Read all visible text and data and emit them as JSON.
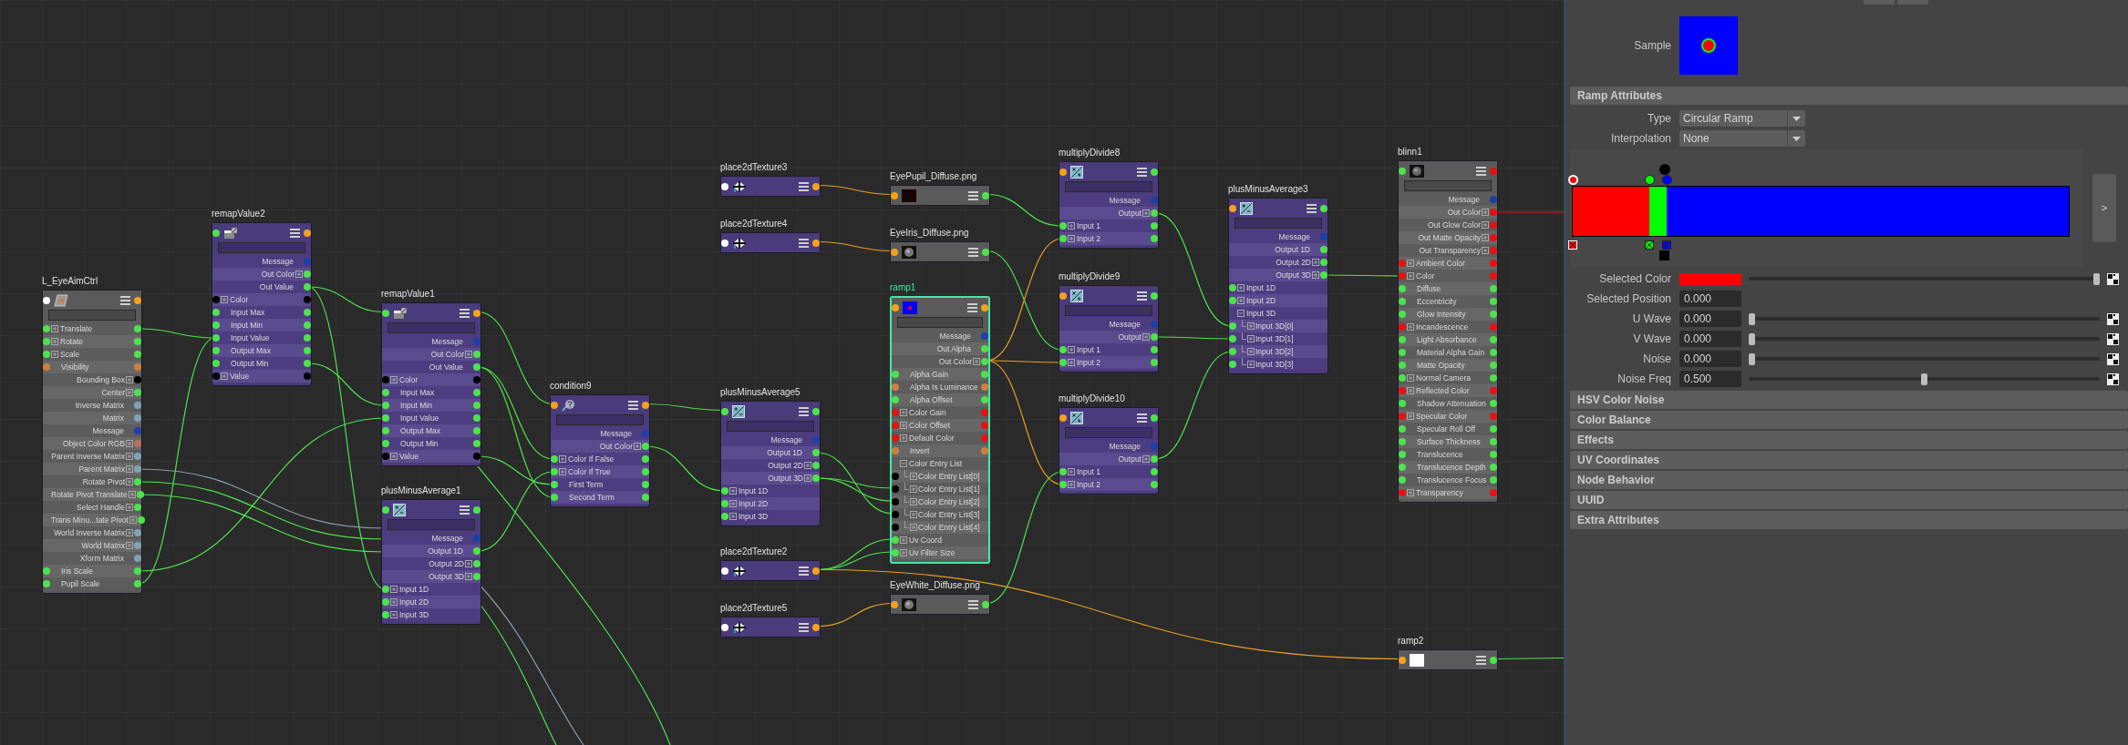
{
  "node_editor": {
    "nodes": [
      {
        "name": "L_EyeAimCtrl",
        "kind": "transform",
        "selected": false,
        "in_port": {
          "color": "#ffffff"
        },
        "out_port": {
          "color": "#f4a21c"
        },
        "attributes": [
          {
            "label": "Translate",
            "kind": "io",
            "compound": true,
            "color": "#4de34d"
          },
          {
            "label": "Rotate",
            "kind": "io",
            "compound": true,
            "color": "#4de34d"
          },
          {
            "label": "Scale",
            "kind": "io",
            "compound": true,
            "color": "#4de34d"
          },
          {
            "label": "Visibility",
            "kind": "io",
            "compound": false,
            "color": "#d0803c"
          },
          {
            "label": "Bounding Box",
            "kind": "out",
            "compound": true,
            "color": "#000000"
          },
          {
            "label": "Center",
            "kind": "out",
            "compound": true,
            "color": "#4de34d"
          },
          {
            "label": "Inverse Matrix",
            "kind": "out",
            "compound": false,
            "color": "#7ea4b8"
          },
          {
            "label": "Matrix",
            "kind": "out",
            "compound": false,
            "color": "#7ea4b8"
          },
          {
            "label": "Message",
            "kind": "out",
            "compound": false,
            "color": "#1c3fa8"
          },
          {
            "label": "Object Color RGB",
            "kind": "out",
            "compound": true,
            "color": "#b87060"
          },
          {
            "label": "Parent Inverse Matrix",
            "kind": "out",
            "compound": true,
            "color": "#7ea4b8"
          },
          {
            "label": "Parent Matrix",
            "kind": "out",
            "compound": true,
            "color": "#7ea4b8"
          },
          {
            "label": "Rotate Pivot",
            "kind": "out",
            "compound": true,
            "color": "#4de34d"
          },
          {
            "label": "Rotate Pivot Translate",
            "kind": "out",
            "compound": true,
            "color": "#4de34d"
          },
          {
            "label": "Select Handle",
            "kind": "out",
            "compound": true,
            "color": "#4de34d"
          },
          {
            "label": "Trans Minu...tate Pivot",
            "kind": "out",
            "compound": true,
            "color": "#4de34d"
          },
          {
            "label": "World Inverse Matrix",
            "kind": "out",
            "compound": true,
            "color": "#7ea4b8"
          },
          {
            "label": "World Matrix",
            "kind": "out",
            "compound": true,
            "color": "#7ea4b8"
          },
          {
            "label": "Xform Matrix",
            "kind": "out",
            "compound": false,
            "color": "#7ea4b8"
          },
          {
            "label": "Iris Scale",
            "kind": "io",
            "compound": false,
            "color": "#4de34d"
          },
          {
            "label": "Pupil Scale",
            "kind": "io",
            "compound": false,
            "color": "#4de34d"
          }
        ]
      },
      {
        "name": "remapValue2",
        "kind": "remap",
        "selected": false,
        "in_port": {
          "color": "#4de34d"
        },
        "out_port": {
          "color": "#f4a21c"
        },
        "attributes": [
          {
            "label": "Message",
            "kind": "out",
            "compound": false,
            "color": "#1c3fa8"
          },
          {
            "label": "Out Color",
            "kind": "out",
            "compound": true,
            "color": "#4de34d"
          },
          {
            "label": "Out Value",
            "kind": "out",
            "compound": false,
            "color": "#4de34d"
          },
          {
            "label": "Color",
            "kind": "io",
            "compound": true,
            "color": "#000000"
          },
          {
            "label": "Input Max",
            "kind": "io",
            "compound": false,
            "color": "#4de34d"
          },
          {
            "label": "Input Min",
            "kind": "io",
            "compound": false,
            "color": "#4de34d"
          },
          {
            "label": "Input Value",
            "kind": "io",
            "compound": false,
            "color": "#4de34d"
          },
          {
            "label": "Output Max",
            "kind": "io",
            "compound": false,
            "color": "#4de34d"
          },
          {
            "label": "Output Min",
            "kind": "io",
            "compound": false,
            "color": "#4de34d"
          },
          {
            "label": "Value",
            "kind": "io",
            "compound": true,
            "color": "#000000"
          }
        ]
      },
      {
        "name": "remapValue1",
        "kind": "remap",
        "selected": false,
        "in_port": {
          "color": "#4de34d"
        },
        "out_port": {
          "color": "#f4a21c"
        },
        "attributes": [
          {
            "label": "Message",
            "kind": "out",
            "compound": false,
            "color": "#1c3fa8"
          },
          {
            "label": "Out Color",
            "kind": "out",
            "compound": true,
            "color": "#4de34d"
          },
          {
            "label": "Out Value",
            "kind": "out",
            "compound": false,
            "color": "#4de34d"
          },
          {
            "label": "Color",
            "kind": "io",
            "compound": true,
            "color": "#000000"
          },
          {
            "label": "Input Max",
            "kind": "io",
            "compound": false,
            "color": "#4de34d"
          },
          {
            "label": "Input Min",
            "kind": "io",
            "compound": false,
            "color": "#4de34d"
          },
          {
            "label": "Input Value",
            "kind": "io",
            "compound": false,
            "color": "#4de34d"
          },
          {
            "label": "Output Max",
            "kind": "io",
            "compound": false,
            "color": "#4de34d"
          },
          {
            "label": "Output Min",
            "kind": "io",
            "compound": false,
            "color": "#4de34d"
          },
          {
            "label": "Value",
            "kind": "io",
            "compound": true,
            "color": "#000000"
          }
        ]
      },
      {
        "name": "plusMinusAverage1",
        "kind": "plus_minus",
        "selected": false,
        "in_port": {
          "color": "#4de34d"
        },
        "out_port": {
          "color": "#4de34d"
        },
        "attributes": [
          {
            "label": "Message",
            "kind": "out",
            "compound": false,
            "color": "#1c3fa8"
          },
          {
            "label": "Output 1D",
            "kind": "out",
            "compound": false,
            "color": "#4de34d"
          },
          {
            "label": "Output 2D",
            "kind": "out",
            "compound": true,
            "color": "#4de34d"
          },
          {
            "label": "Output 3D",
            "kind": "out",
            "compound": true,
            "color": "#4de34d"
          },
          {
            "label": "Input 1D",
            "kind": "in",
            "compound": true,
            "color": "#4de34d"
          },
          {
            "label": "Input 2D",
            "kind": "in",
            "compound": true,
            "color": "#4de34d"
          },
          {
            "label": "Input 3D",
            "kind": "in",
            "compound": true,
            "color": "#4de34d"
          }
        ]
      },
      {
        "name": "condition9",
        "kind": "condition",
        "selected": false,
        "in_port": {
          "color": "#f4a21c"
        },
        "out_port": {
          "color": "#f4a21c"
        },
        "attributes": [
          {
            "label": "Message",
            "kind": "out",
            "compound": false,
            "color": "#1c3fa8"
          },
          {
            "label": "Out Color",
            "kind": "out",
            "compound": true,
            "color": "#4de34d"
          },
          {
            "label": "Color If False",
            "kind": "io",
            "compound": true,
            "color": "#4de34d"
          },
          {
            "label": "Color If True",
            "kind": "io",
            "compound": true,
            "color": "#4de34d"
          },
          {
            "label": "First Term",
            "kind": "io",
            "compound": false,
            "color": "#4de34d"
          },
          {
            "label": "Second Term",
            "kind": "io",
            "compound": false,
            "color": "#4de34d"
          }
        ]
      },
      {
        "name": "place2dTexture3",
        "kind": "place2d",
        "selected": false,
        "in_port": {
          "color": "#ffffff"
        },
        "out_port": {
          "color": "#f4a21c"
        }
      },
      {
        "name": "place2dTexture4",
        "kind": "place2d",
        "selected": false,
        "in_port": {
          "color": "#ffffff"
        },
        "out_port": {
          "color": "#f4a21c"
        }
      },
      {
        "name": "plusMinusAverage5",
        "kind": "plus_minus",
        "selected": false,
        "in_port": {
          "color": "#4de34d"
        },
        "out_port": {
          "color": "#4de34d"
        },
        "attributes": [
          {
            "label": "Message",
            "kind": "out",
            "compound": false,
            "color": "#1c3fa8"
          },
          {
            "label": "Output 1D",
            "kind": "out",
            "compound": false,
            "color": "#4de34d"
          },
          {
            "label": "Output 2D",
            "kind": "out",
            "compound": true,
            "color": "#4de34d"
          },
          {
            "label": "Output 3D",
            "kind": "out",
            "compound": true,
            "color": "#4de34d"
          },
          {
            "label": "Input 1D",
            "kind": "in",
            "compound": true,
            "color": "#4de34d"
          },
          {
            "label": "Input 2D",
            "kind": "in",
            "compound": true,
            "color": "#4de34d"
          },
          {
            "label": "Input 3D",
            "kind": "in",
            "compound": true,
            "color": "#4de34d"
          }
        ]
      },
      {
        "name": "place2dTexture2",
        "kind": "place2d",
        "selected": false,
        "in_port": {
          "color": "#ffffff"
        },
        "out_port": {
          "color": "#f4a21c"
        }
      },
      {
        "name": "place2dTexture5",
        "kind": "place2d",
        "selected": false,
        "in_port": {
          "color": "#ffffff"
        },
        "out_port": {
          "color": "#f4a21c"
        }
      },
      {
        "name": "EyePupil_Diffuse.png",
        "kind": "file",
        "selected": false,
        "in_port": {
          "color": "#f4a21c"
        },
        "out_port": {
          "color": "#4de34d"
        },
        "color": "#140404"
      },
      {
        "name": "EyeIris_Diffuse.png",
        "kind": "file",
        "selected": false,
        "in_port": {
          "color": "#f4a21c"
        },
        "out_port": {
          "color": "#4de34d"
        }
      },
      {
        "name": "ramp1",
        "kind": "ramp",
        "selected": true,
        "in_port": {
          "color": "#f4a21c"
        },
        "out_port": {
          "color": "#f4a21c"
        },
        "color": "#0000ff",
        "dot": {
          "color": "#ff0000"
        },
        "attributes": [
          {
            "label": "Message",
            "kind": "out",
            "compound": false,
            "color": "#1c3fa8"
          },
          {
            "label": "Out Alpha",
            "kind": "out",
            "compound": false,
            "color": "#4de34d"
          },
          {
            "label": "Out Color",
            "kind": "out",
            "compound": true,
            "color": "#4de34d"
          },
          {
            "label": "Alpha Gain",
            "kind": "io",
            "compound": false,
            "color": "#4de34d"
          },
          {
            "label": "Alpha Is Luminance",
            "kind": "io",
            "compound": false,
            "color": "#d0803c"
          },
          {
            "label": "Alpha Offset",
            "kind": "io",
            "compound": false,
            "color": "#4de34d"
          },
          {
            "label": "Color Gain",
            "kind": "io",
            "compound": true,
            "color": "#e81010"
          },
          {
            "label": "Color Offset",
            "kind": "io",
            "compound": true,
            "color": "#e81010"
          },
          {
            "label": "Default Color",
            "kind": "io",
            "compound": true,
            "color": "#e81010"
          },
          {
            "label": "Invert",
            "kind": "io",
            "compound": false,
            "color": "#d0803c"
          },
          {
            "label": "Color Entry List",
            "kind": "group",
            "expanded": true,
            "children": [
              {
                "label": "Color Entry List[0]",
                "compound": true,
                "color": "#000000"
              },
              {
                "label": "Color Entry List[1]",
                "compound": true,
                "color": "#000000"
              },
              {
                "label": "Color Entry List[2]",
                "compound": true,
                "color": "#000000"
              },
              {
                "label": "Color Entry List[3]",
                "compound": true,
                "color": "#000000"
              },
              {
                "label": "Color Entry List[4]",
                "compound": true,
                "color": "#000000"
              }
            ]
          },
          {
            "label": "Uv Coord",
            "kind": "in",
            "compound": true,
            "color": "#4de34d"
          },
          {
            "label": "Uv Filter Size",
            "kind": "in",
            "compound": true,
            "color": "#4de34d"
          }
        ]
      },
      {
        "name": "EyeWhite_Diffuse.png",
        "kind": "file",
        "selected": false,
        "in_port": {
          "color": "#f4a21c"
        },
        "out_port": {
          "color": "#4de34d"
        }
      },
      {
        "name": "multiplyDivide8",
        "kind": "multiply_divide",
        "selected": false,
        "in_port": {
          "color": "#f4a21c"
        },
        "out_port": {
          "color": "#4de34d"
        },
        "attributes": [
          {
            "label": "Message",
            "kind": "out",
            "compound": false,
            "color": "#1c3fa8"
          },
          {
            "label": "Output",
            "kind": "out",
            "compound": true,
            "color": "#4de34d"
          },
          {
            "label": "Input 1",
            "kind": "io",
            "compound": true,
            "color": "#4de34d"
          },
          {
            "label": "Input 2",
            "kind": "io",
            "compound": true,
            "color": "#4de34d"
          }
        ]
      },
      {
        "name": "multiplyDivide9",
        "kind": "multiply_divide",
        "selected": false,
        "in_port": {
          "color": "#f4a21c"
        },
        "out_port": {
          "color": "#4de34d"
        },
        "attributes": [
          {
            "label": "Message",
            "kind": "out",
            "compound": false,
            "color": "#1c3fa8"
          },
          {
            "label": "Output",
            "kind": "out",
            "compound": true,
            "color": "#4de34d"
          },
          {
            "label": "Input 1",
            "kind": "io",
            "compound": true,
            "color": "#4de34d"
          },
          {
            "label": "Input 2",
            "kind": "io",
            "compound": true,
            "color": "#4de34d"
          }
        ]
      },
      {
        "name": "multiplyDivide10",
        "kind": "multiply_divide",
        "selected": false,
        "in_port": {
          "color": "#f4a21c"
        },
        "out_port": {
          "color": "#4de34d"
        },
        "attributes": [
          {
            "label": "Message",
            "kind": "out",
            "compound": false,
            "color": "#1c3fa8"
          },
          {
            "label": "Output",
            "kind": "out",
            "compound": true,
            "color": "#4de34d"
          },
          {
            "label": "Input 1",
            "kind": "io",
            "compound": true,
            "color": "#4de34d"
          },
          {
            "label": "Input 2",
            "kind": "io",
            "compound": true,
            "color": "#4de34d"
          }
        ]
      },
      {
        "name": "plusMinusAverage3",
        "kind": "plus_minus",
        "selected": false,
        "in_port": {
          "color": "#f4a21c"
        },
        "out_port": {
          "color": "#4de34d"
        },
        "attributes": [
          {
            "label": "Message",
            "kind": "out",
            "compound": false,
            "color": "#1c3fa8"
          },
          {
            "label": "Output 1D",
            "kind": "out",
            "compound": false,
            "color": "#4de34d"
          },
          {
            "label": "Output 2D",
            "kind": "out",
            "compound": true,
            "color": "#4de34d"
          },
          {
            "label": "Output 3D",
            "kind": "out",
            "compound": true,
            "color": "#4de34d"
          },
          {
            "label": "Input 1D",
            "kind": "in",
            "compound": true,
            "color": "#4de34d"
          },
          {
            "label": "Input 2D",
            "kind": "in",
            "compound": true,
            "color": "#4de34d"
          },
          {
            "label": "Input 3D",
            "kind": "group",
            "expanded": true,
            "children": [
              {
                "label": "Input 3D[0]",
                "compound": true,
                "color": "#4de34d"
              },
              {
                "label": "Input 3D[1]",
                "compound": true,
                "color": "#4de34d"
              },
              {
                "label": "Input 3D[2]",
                "compound": true,
                "color": "#4de34d"
              },
              {
                "label": "Input 3D[3]",
                "compound": true,
                "color": "#4de34d"
              }
            ]
          }
        ]
      },
      {
        "name": "blinn1",
        "kind": "blinn",
        "selected": false,
        "in_port": {
          "color": "#4de34d"
        },
        "out_port": {
          "color": "#e81010"
        },
        "attributes": [
          {
            "label": "Message",
            "kind": "out",
            "compound": false,
            "color": "#1c3fa8"
          },
          {
            "label": "Out Color",
            "kind": "out",
            "compound": true,
            "color": "#e81010"
          },
          {
            "label": "Out Glow Color",
            "kind": "out",
            "compound": true,
            "color": "#e81010"
          },
          {
            "label": "Out Matte Opacity",
            "kind": "out",
            "compound": true,
            "color": "#e81010"
          },
          {
            "label": "Out Transparency",
            "kind": "out",
            "compound": true,
            "color": "#e81010"
          },
          {
            "label": "Ambient Color",
            "kind": "io",
            "compound": true,
            "color": "#e81010"
          },
          {
            "label": "Color",
            "kind": "io",
            "compound": true,
            "color": "#e81010"
          },
          {
            "label": "Diffuse",
            "kind": "io",
            "compound": false,
            "color": "#4de34d"
          },
          {
            "label": "Eccentricity",
            "kind": "io",
            "compound": false,
            "color": "#4de34d"
          },
          {
            "label": "Glow Intensity",
            "kind": "io",
            "compound": false,
            "color": "#4de34d"
          },
          {
            "label": "Incandescence",
            "kind": "io",
            "compound": true,
            "color": "#e81010"
          },
          {
            "label": "Light Absorbance",
            "kind": "io",
            "compound": false,
            "color": "#4de34d"
          },
          {
            "label": "Material Alpha Gain",
            "kind": "io",
            "compound": false,
            "color": "#4de34d"
          },
          {
            "label": "Matte Opacity",
            "kind": "io",
            "compound": false,
            "color": "#4de34d"
          },
          {
            "label": "Normal Camera",
            "kind": "io",
            "compound": true,
            "color": "#4de34d"
          },
          {
            "label": "Reflected Color",
            "kind": "io",
            "compound": true,
            "color": "#e81010"
          },
          {
            "label": "Shadow Attenuation",
            "kind": "io",
            "compound": false,
            "color": "#4de34d"
          },
          {
            "label": "Specular Color",
            "kind": "io",
            "compound": true,
            "color": "#e81010"
          },
          {
            "label": "Specular Roll Off",
            "kind": "io",
            "compound": false,
            "color": "#4de34d"
          },
          {
            "label": "Surface Thickness",
            "kind": "io",
            "compound": false,
            "color": "#4de34d"
          },
          {
            "label": "Translucence",
            "kind": "io",
            "compound": false,
            "color": "#4de34d"
          },
          {
            "label": "Translucence Depth",
            "kind": "io",
            "compound": false,
            "color": "#4de34d"
          },
          {
            "label": "Translucence Focus",
            "kind": "io",
            "compound": false,
            "color": "#4de34d"
          },
          {
            "label": "Transparency",
            "kind": "io",
            "compound": true,
            "color": "#e81010"
          }
        ]
      },
      {
        "name": "ramp2",
        "kind": "ramp",
        "selected": false,
        "in_port": {
          "color": "#f4a21c"
        },
        "out_port": {
          "color": "#4de34d"
        },
        "color": "#ffffff"
      }
    ]
  },
  "attribute_editor": {
    "sample": {
      "label": "Sample"
    },
    "ramp_attributes": {
      "title": "Ramp Attributes",
      "dropdowns": [
        {
          "label": "Type",
          "value": "Circular Ramp"
        },
        {
          "label": "Interpolation",
          "value": "None"
        }
      ],
      "ramp": {
        "stops": [
          {
            "color": "#ff0000",
            "level": 0,
            "selected": true
          },
          {
            "color": "#00ff00",
            "level": 0.155,
            "selected": false
          },
          {
            "color": "#0000ff",
            "level": 0.19,
            "selected": false
          }
        ],
        "cursor": {
          "level": 0.185
        },
        "expand_label": ">"
      },
      "rows": [
        {
          "kind": "color",
          "label": "Selected Color",
          "color": "#ff0000",
          "level": 1
        },
        {
          "kind": "field",
          "label": "Selected Position",
          "value": "0.000"
        },
        {
          "kind": "slider",
          "label": "U Wave",
          "value": "0.000",
          "level": 0
        },
        {
          "kind": "slider",
          "label": "V Wave",
          "value": "0.000",
          "level": 0
        },
        {
          "kind": "slider",
          "label": "Noise",
          "value": "0.000",
          "level": 0
        },
        {
          "kind": "slider",
          "label": "Noise Freq",
          "value": "0.500",
          "level": 0.5
        }
      ]
    },
    "collapsed_sections": [
      {
        "title": "HSV Color Noise"
      },
      {
        "title": "Color Balance"
      },
      {
        "title": "Effects"
      },
      {
        "title": "UV Coordinates"
      },
      {
        "title": "Node Behavior"
      },
      {
        "title": "UUID"
      },
      {
        "title": "Extra Attributes"
      }
    ]
  }
}
